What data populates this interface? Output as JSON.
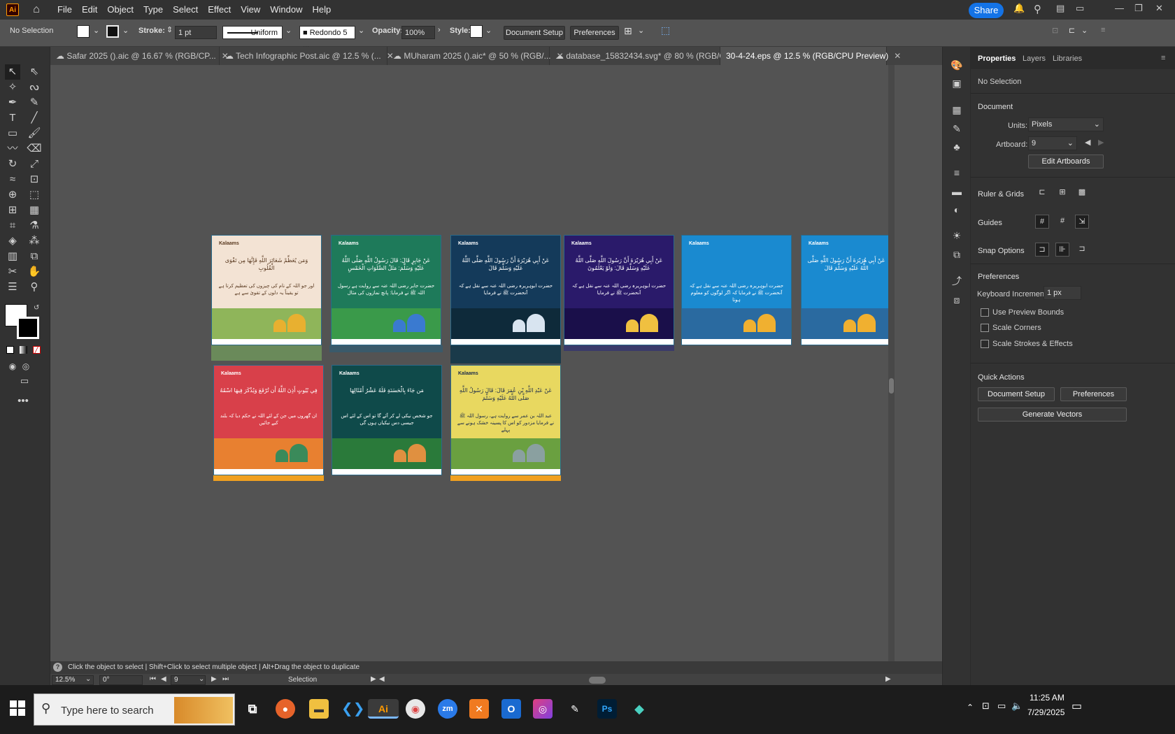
{
  "app": {
    "logo": "Ai",
    "home_icon": "home-icon"
  },
  "menu": [
    "File",
    "Edit",
    "Object",
    "Type",
    "Select",
    "Effect",
    "View",
    "Window",
    "Help"
  ],
  "share_label": "Share",
  "control_bar": {
    "selection": "No Selection",
    "stroke_label": "Stroke:",
    "stroke_value": "1 pt",
    "profile": "Uniform",
    "brush": "Redondo 5 ...",
    "opacity_label": "Opacity:",
    "opacity_value": "100%",
    "style_label": "Style:",
    "document_setup": "Document Setup",
    "preferences": "Preferences"
  },
  "tabs": [
    {
      "label": "Safar 2025 ().aic @ 16.67 % (RGB/CP...",
      "active": false
    },
    {
      "label": "Tech Infographic Post.aic @ 12.5 % (...",
      "active": false
    },
    {
      "label": "MUharam 2025 ().aic* @ 50 % (RGB/...",
      "active": false
    },
    {
      "label": "database_15832434.svg* @ 80 % (RGB/C...",
      "active": false
    },
    {
      "label": "30-4-24.eps @ 12.5 % (RGB/CPU Preview)",
      "active": true
    }
  ],
  "artboards": [
    {
      "brand": "Kalaams",
      "bg": "#f3e3d4",
      "text_color": "#5a3a20",
      "arabic": "وَمَن يُعَظِّمْ شَعَائِرَ اللَّهِ فَإِنَّهَا مِن تَقْوَى الْقُلُوبِ",
      "urdu": "اور جو اللہ کے نام کی چیزوں کی تعظیم کرتا ہے تو یقیناً یہ دلوں کے تقویٰ سے ہے",
      "ground": "#8fb55a",
      "dome": "#e8b030"
    },
    {
      "brand": "Kalaams",
      "bg": "#1e7a5a",
      "text_color": "#ffffff",
      "arabic": "عَنْ جَابِرٍ قَالَ: قَالَ رَسُولُ اللَّهِ صَلَّى اللَّهُ عَلَيْهِ وَسَلَّمَ: مَثَلُ الصَّلَوَاتِ الْخَمْسِ",
      "urdu": "حضرت جابر رضی اللہ عنہ سے روایت ہے رسول اللہ ﷺ نے فرمایا: پانچ نمازوں کی مثال",
      "ground": "#3a9a4a",
      "dome": "#3a7ad0"
    },
    {
      "brand": "Kalaams",
      "bg": "#143a5a",
      "text_color": "#ffffff",
      "arabic": "عَنْ أَبِي هُرَيْرَةَ أَنَّ رَسُولَ اللَّهِ صَلَّى اللَّهُ عَلَيْهِ وَسَلَّمَ قَالَ",
      "urdu": "حضرت ابوہریرہ رضی اللہ عنہ سے نقل ہے کہ آنحضرت ﷺ نے فرمایا",
      "ground": "#0e2a3a",
      "dome": "#d8e4f0"
    },
    {
      "brand": "Kalaams",
      "bg": "#2a1a6a",
      "text_color": "#ffffff",
      "arabic": "عَنْ أَبِي هُرَيْرَةَ أَنَّ رَسُولَ اللَّهِ صَلَّى اللَّهُ عَلَيْهِ وَسَلَّمَ قَالَ: وَلَوْ يَعْلَمُونَ",
      "urdu": "حضرت ابوہریرہ رضی اللہ عنہ سے نقل ہے کہ آنحضرت ﷺ نے فرمایا",
      "ground": "#1a0f4a",
      "dome": "#f0c040"
    },
    {
      "brand": "Kalaams",
      "bg": "#1a8ad0",
      "text_color": "#ffffff",
      "arabic": "",
      "urdu": "حضرت ابوہریرہ رضی اللہ عنہ سے نقل ہے کہ آنحضرت ﷺ نے فرمایا کہ اگر لوگوں کو معلوم ہوتا",
      "ground": "#2a6aa0",
      "dome": "#f0b030"
    },
    {
      "brand": "Kalaams",
      "bg": "#1a8ad0",
      "text_color": "#ffffff",
      "arabic": "عَنْ أَبِي هُرَيْرَةَ أَنَّ رَسُولَ اللَّهِ صَلَّى اللَّهُ عَلَيْهِ وَسَلَّمَ قَالَ",
      "urdu": "",
      "ground": "#2a6aa0",
      "dome": "#f0b030"
    },
    {
      "brand": "Kalaams",
      "bg": "#d8404a",
      "text_color": "#ffffff",
      "arabic": "فِي بُيُوتٍ أَذِنَ اللَّهُ أَن تُرْفَعَ وَيُذْكَرَ فِيهَا اسْمُهُ",
      "urdu": "ان گھروں میں جن کے لئے اللہ نے حکم دیا کہ بلند کیے جائیں",
      "ground": "#e88030",
      "dome": "#3a8a5a"
    },
    {
      "brand": "Kalaams",
      "bg": "#0f4a4a",
      "text_color": "#ffffff",
      "arabic": "مَن جَاءَ بِالْحَسَنَةِ فَلَهُ عَشْرُ أَمْثَالِهَا",
      "urdu": "جو شخص نیکی لے کر آئے گا تو اس کے لئے اس جیسی دس نیکیاں ہوں گی",
      "ground": "#2a7a3a",
      "dome": "#e09040"
    },
    {
      "brand": "Kalaams",
      "bg": "#e8d860",
      "text_color": "#1a2a4a",
      "arabic": "عَنْ عَبْدِ اللَّهِ بْنِ عُمَرَ قَالَ: قَالَ رَسُولُ اللَّهِ صَلَّى اللَّهُ عَلَيْهِ وَسَلَّمَ",
      "urdu": "عبد اللہ بن عمر سے روایت ہے، رسول اللہ ﷺ نے فرمایا مزدور کو اس کا پسینہ خشک ہونے سے پہلے",
      "ground": "#6aa040",
      "dome": "#8aa0a0"
    }
  ],
  "panel": {
    "tabs": [
      "Properties",
      "Layers",
      "Libraries"
    ],
    "selection": "No Selection",
    "document_heading": "Document",
    "units_label": "Units:",
    "units_value": "Pixels",
    "artboard_label": "Artboard:",
    "artboard_value": "9",
    "edit_artboards": "Edit Artboards",
    "ruler_grids": "Ruler & Grids",
    "guides": "Guides",
    "snap_options": "Snap Options",
    "preferences_heading": "Preferences",
    "keyboard_increment_label": "Keyboard Increment:",
    "keyboard_increment_value": "1 px",
    "checkboxes": [
      "Use Preview Bounds",
      "Scale Corners",
      "Scale Strokes & Effects"
    ],
    "quick_actions": "Quick Actions",
    "qa_document_setup": "Document Setup",
    "qa_preferences": "Preferences",
    "qa_generate_vectors": "Generate Vectors"
  },
  "status": {
    "hint": "Click the object to select | Shift+Click to select multiple object | Alt+Drag the object to duplicate",
    "zoom": "12.5%",
    "rotation": "0°",
    "artboard": "9",
    "tool": "Selection"
  },
  "taskbar": {
    "search_placeholder": "Type here to search",
    "time": "11:25 AM",
    "date": "7/29/2025"
  }
}
